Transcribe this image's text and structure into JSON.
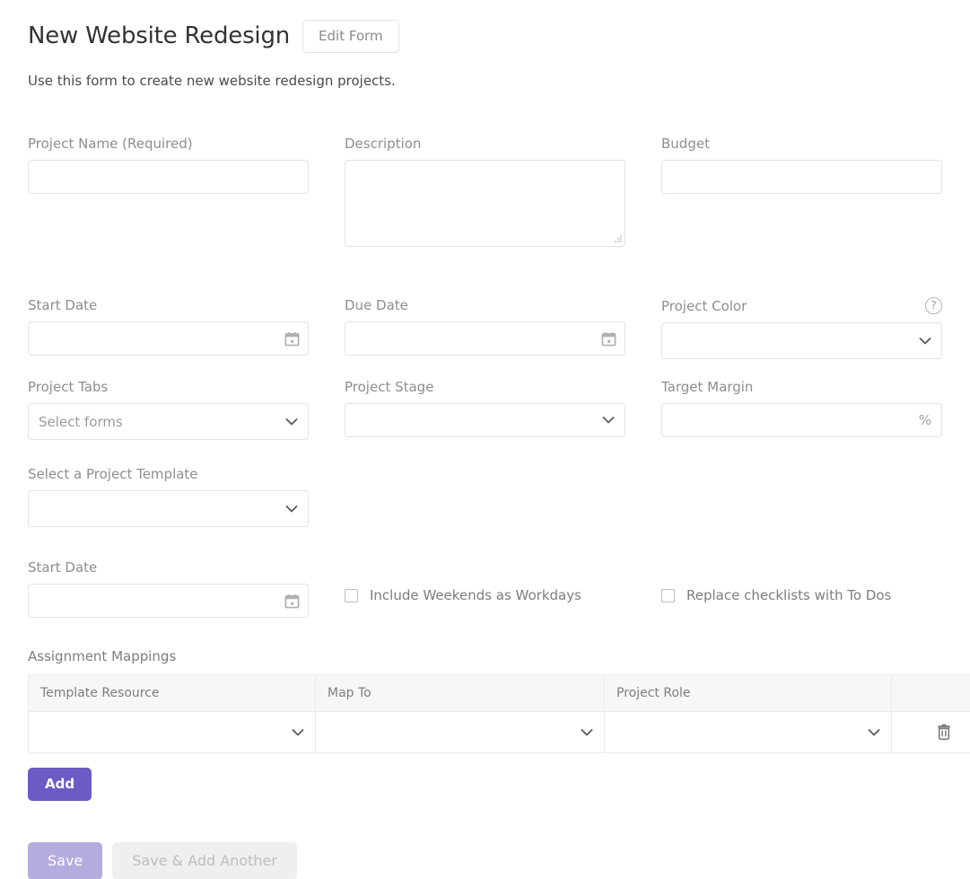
{
  "header": {
    "title": "New Website Redesign",
    "edit_form_label": "Edit Form",
    "subtitle": "Use this form to create new website redesign projects."
  },
  "fields": {
    "project_name": {
      "label": "Project Name (Required)",
      "value": "",
      "placeholder": ""
    },
    "description": {
      "label": "Description",
      "value": "",
      "placeholder": ""
    },
    "budget": {
      "label": "Budget",
      "value": "",
      "placeholder": ""
    },
    "start_date": {
      "label": "Start Date",
      "value": "",
      "placeholder": "",
      "icon": "calendar-icon"
    },
    "due_date": {
      "label": "Due Date",
      "value": "",
      "placeholder": "",
      "icon": "calendar-icon"
    },
    "project_color": {
      "label": "Project Color",
      "value": "",
      "help_icon": "help-circle-icon"
    },
    "project_tabs": {
      "label": "Project Tabs",
      "value": "Select forms"
    },
    "project_stage": {
      "label": "Project Stage",
      "value": ""
    },
    "target_margin": {
      "label": "Target Margin",
      "value": "",
      "suffix": "%"
    },
    "project_template": {
      "label": "Select a Project Template",
      "value": ""
    },
    "template_start_date": {
      "label": "Start Date",
      "value": "",
      "icon": "calendar-icon"
    }
  },
  "checkboxes": [
    {
      "label": "Include Weekends as Workdays",
      "checked": false
    },
    {
      "label": "Replace checklists with To Dos",
      "checked": false
    }
  ],
  "mappings": {
    "title": "Assignment Mappings",
    "columns": [
      "Template Resource",
      "Map To",
      "Project Role"
    ],
    "rows": [
      {
        "template_resource": "",
        "map_to": "",
        "project_role": "",
        "delete_icon": "trash-icon"
      }
    ],
    "add_label": "Add"
  },
  "footer": {
    "save_label": "Save",
    "save_add_another_label": "Save & Add Another"
  },
  "colors": {
    "accent": "#6c5bc4",
    "accent_muted": "#b5acde",
    "disabled_bg": "#efefef",
    "border": "#e3e3e3",
    "table_header_bg": "#f7f7f7",
    "label_text": "#8e8e8e"
  }
}
